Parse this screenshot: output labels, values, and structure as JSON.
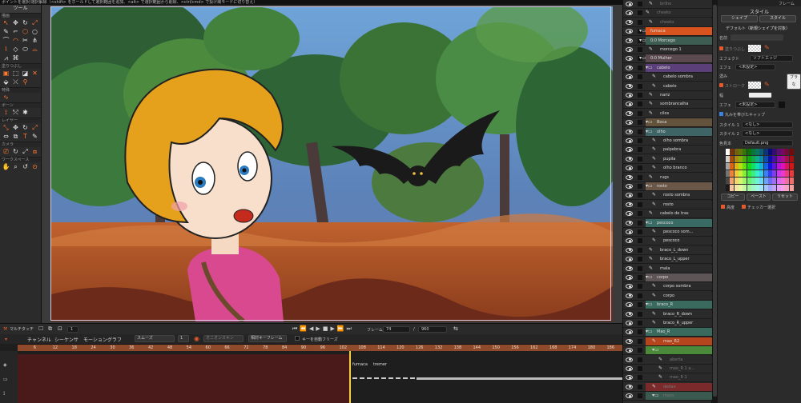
{
  "hint": "ポイントを選択/選択解除（<shift> をホールドして選択範囲を追加、<alt> で選択範囲から削除、<ctrl/cmd> で投げ縄モードに切り替え）",
  "tools": {
    "title": "ツール",
    "sections": [
      {
        "label": "描画",
        "icons": [
          "↖",
          "✥",
          "↻",
          "⤢",
          "✎",
          "⌐",
          "⬡",
          "○",
          "⌒",
          "◠",
          "✂",
          "⋔",
          "⌇",
          "◇",
          "⬭",
          "⌓",
          "⩘",
          "⌘"
        ]
      },
      {
        "label": "塗りつぶし",
        "icons": [
          "▣",
          "⬚",
          "◪",
          "✕",
          "⬙",
          "⤫",
          "⚲"
        ]
      },
      {
        "label": "特殊",
        "icons": [
          "∿"
        ]
      },
      {
        "label": "ボーン",
        "icons": [
          "⟟",
          "⤲",
          "✱"
        ]
      },
      {
        "label": "レイヤー",
        "icons": [
          "⤡",
          "✥",
          "↻",
          "⤢",
          "⇔",
          "⧉",
          "T",
          "✎"
        ]
      },
      {
        "label": "カメラ",
        "icons": [
          "⎚",
          "↻",
          "⤢",
          "⧈"
        ]
      },
      {
        "label": "ワークスペース",
        "icons": [
          "✋",
          "⌕",
          "↺",
          "⊙"
        ]
      }
    ]
  },
  "controls": {
    "multi_touch": "マルチタッチ",
    "frame_label": "フレーム",
    "frame_value": "74",
    "of_label": "/",
    "end_value": "960",
    "start_value": "1"
  },
  "timeline": {
    "tabs": [
      "チャンネル",
      "シーケンサ",
      "モーショングラフ"
    ],
    "interp": "スムーズ",
    "interp_num": "1",
    "onion": "オニオンスキン",
    "relative_kf": "相対キーフレーム",
    "auto_freeze": "キーを自動フリーズ",
    "ruler": [
      "6",
      "12",
      "18",
      "24",
      "30",
      "36",
      "42",
      "48",
      "54",
      "60",
      "66",
      "72",
      "78",
      "84",
      "90",
      "96",
      "102",
      "108",
      "114",
      "120",
      "126",
      "132",
      "138",
      "144",
      "150",
      "156",
      "162",
      "168",
      "174",
      "180",
      "186",
      "192",
      "198",
      "204",
      "210",
      "216",
      "222",
      "228",
      "234",
      "240"
    ],
    "markers": [
      "furnaca",
      "tremer"
    ]
  },
  "layers": [
    {
      "name": "brilho",
      "indent": 40,
      "color": "#2a2a2a",
      "dim": true,
      "type": "vec"
    },
    {
      "name": "cheeks",
      "indent": 36,
      "color": "#2a2a2a",
      "dim": true,
      "type": "vec"
    },
    {
      "name": "cheeks",
      "indent": 40,
      "color": "#2a2a2a",
      "dim": true,
      "type": "vec"
    },
    {
      "name": "fumaca",
      "indent": 28,
      "color": "#d9531e",
      "dim": false,
      "type": "grp"
    },
    {
      "name": "0:0  Morcego",
      "indent": 28,
      "color": "#3d5c52",
      "dim": false,
      "type": "grp"
    },
    {
      "name": "morcego 1",
      "indent": 40,
      "color": "#2a2a2a",
      "dim": false,
      "type": "vec"
    },
    {
      "name": "0:0  Mulher",
      "indent": 28,
      "color": "#5a4a4f",
      "dim": false,
      "type": "grp"
    },
    {
      "name": "cabelo",
      "indent": 36,
      "color": "#5b3f78",
      "dim": false,
      "type": "grp"
    },
    {
      "name": "cabelo sombra",
      "indent": 44,
      "color": "#2a2a2a",
      "dim": false,
      "type": "vec"
    },
    {
      "name": "cabelo",
      "indent": 44,
      "color": "#2a2a2a",
      "dim": false,
      "type": "vec"
    },
    {
      "name": "nariz",
      "indent": 40,
      "color": "#2a2a2a",
      "dim": false,
      "type": "vec"
    },
    {
      "name": "sombrancalha",
      "indent": 40,
      "color": "#2a2a2a",
      "dim": false,
      "type": "vec"
    },
    {
      "name": "cilos",
      "indent": 40,
      "color": "#2a2a2a",
      "dim": false,
      "type": "vec"
    },
    {
      "name": "Boca",
      "indent": 36,
      "color": "#63533c",
      "dim": false,
      "type": "grp"
    },
    {
      "name": "olho",
      "indent": 36,
      "color": "#3f6466",
      "dim": false,
      "type": "grp"
    },
    {
      "name": "olho sombra",
      "indent": 44,
      "color": "#2a2a2a",
      "dim": false,
      "type": "vec"
    },
    {
      "name": "palpebra",
      "indent": 44,
      "color": "#2a2a2a",
      "dim": false,
      "type": "vec"
    },
    {
      "name": "pupila",
      "indent": 44,
      "color": "#2a2a2a",
      "dim": false,
      "type": "vec"
    },
    {
      "name": "olho branco",
      "indent": 44,
      "color": "#2a2a2a",
      "dim": false,
      "type": "vec"
    },
    {
      "name": "rugs",
      "indent": 40,
      "color": "#2a2a2a",
      "dim": false,
      "type": "vec"
    },
    {
      "name": "rosto",
      "indent": 36,
      "color": "#6b5748",
      "dim": false,
      "type": "grp"
    },
    {
      "name": "rosto sombra",
      "indent": 44,
      "color": "#2a2a2a",
      "dim": false,
      "type": "vec"
    },
    {
      "name": "rosto",
      "indent": 44,
      "color": "#2a2a2a",
      "dim": false,
      "type": "vec"
    },
    {
      "name": "cabelo de tras",
      "indent": 40,
      "color": "#2a2a2a",
      "dim": false,
      "type": "vec"
    },
    {
      "name": "pescoco",
      "indent": 36,
      "color": "#3a6a64",
      "dim": false,
      "type": "grp"
    },
    {
      "name": "pescoco som...",
      "indent": 44,
      "color": "#2a2a2a",
      "dim": false,
      "type": "vec"
    },
    {
      "name": "pescoco",
      "indent": 44,
      "color": "#2a2a2a",
      "dim": false,
      "type": "vec"
    },
    {
      "name": "braco_L_down",
      "indent": 40,
      "color": "#2a2a2a",
      "dim": false,
      "type": "vec"
    },
    {
      "name": "braco_L_upper",
      "indent": 40,
      "color": "#2a2a2a",
      "dim": false,
      "type": "vec"
    },
    {
      "name": "mala",
      "indent": 40,
      "color": "#2a2a2a",
      "dim": false,
      "type": "vec"
    },
    {
      "name": "corpo",
      "indent": 36,
      "color": "#5e5557",
      "dim": false,
      "type": "grp"
    },
    {
      "name": "corpo sombra",
      "indent": 44,
      "color": "#2a2a2a",
      "dim": false,
      "type": "vec"
    },
    {
      "name": "corpo",
      "indent": 44,
      "color": "#2a2a2a",
      "dim": false,
      "type": "vec"
    },
    {
      "name": "braco_R",
      "indent": 36,
      "color": "#3a6a5e",
      "dim": false,
      "type": "grp"
    },
    {
      "name": "braco_R_down",
      "indent": 44,
      "color": "#2a2a2a",
      "dim": false,
      "type": "vec"
    },
    {
      "name": "braco_R_upper",
      "indent": 44,
      "color": "#2a2a2a",
      "dim": false,
      "type": "vec"
    },
    {
      "name": "Mao_R",
      "indent": 36,
      "color": "#3a6a5e",
      "dim": false,
      "type": "grp"
    },
    {
      "name": "mao_R2",
      "indent": 44,
      "color": "#b5451d",
      "dim": false,
      "type": "vec"
    },
    {
      "name": "",
      "indent": 44,
      "color": "#4a8a3a",
      "dim": false,
      "type": "grp"
    },
    {
      "name": "aberta",
      "indent": 52,
      "color": "#2a2a2a",
      "dim": true,
      "type": "vec"
    },
    {
      "name": "mao_R 1 a...",
      "indent": 52,
      "color": "#2a2a2a",
      "dim": true,
      "type": "vec"
    },
    {
      "name": "mao_R 1",
      "indent": 52,
      "color": "#2a2a2a",
      "dim": true,
      "type": "vec"
    },
    {
      "name": "dedao",
      "indent": 44,
      "color": "#7a2a2a",
      "dim": true,
      "type": "vec"
    },
    {
      "name": "maos",
      "indent": 44,
      "color": "#3a5a50",
      "dim": true,
      "type": "grp"
    }
  ],
  "props": {
    "header": "フレーム",
    "title": "スタイル",
    "tab_shape": "シェイプ",
    "tab_style": "スタイル",
    "default_label": "デフォルト（新規シェイプを対象）",
    "name_label": "名前",
    "fill_label": "塗りつぶし",
    "effect_label": "エフェクト",
    "effect_value": "ソフトエッジ",
    "effect2_label": "エフェ",
    "effect2_value": "<未設定>",
    "density_label": "濃み",
    "stroke_label": "ストローク",
    "width_label": "幅",
    "effect3_label": "エフェ",
    "effect3_value": "<未設定>",
    "snap_label": "丸みを帯びたキャップ",
    "style1_label": "スタイル 1",
    "style1_value": "<なし>",
    "style2_label": "スタイル 2",
    "style2_value": "<なし>",
    "palette_label": "色見本",
    "palette_value": "Default.png",
    "copy_btn": "コピー",
    "paste_btn": "ペースト",
    "reset_btn": "リセット",
    "advanced_label": "高度",
    "checker_label": "チェッカー選択",
    "brush_btn": "ブラ",
    "brush_btn2": "な"
  },
  "colors": {
    "accent": "#e45a2a",
    "track_red": "#4a1a1a",
    "ruler": "#8f4a2c"
  }
}
